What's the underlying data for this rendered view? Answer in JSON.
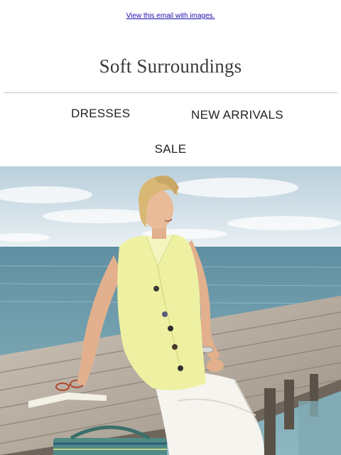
{
  "header": {
    "view_link": "View this email with images.",
    "logo_text": "Soft Surroundings"
  },
  "nav": {
    "items": [
      {
        "label": "DRESSES"
      },
      {
        "label": "NEW ARRIVALS"
      },
      {
        "label": "SALE"
      }
    ]
  },
  "hero": {
    "image": "woman-in-yellow-sleeveless-top-sitting-on-dock",
    "colors": {
      "sky": "#dfe9ef",
      "sea": "#6b97a6",
      "dock": "#b3a79a",
      "top": "#eef0a2",
      "pants": "#f6f4ef"
    }
  }
}
